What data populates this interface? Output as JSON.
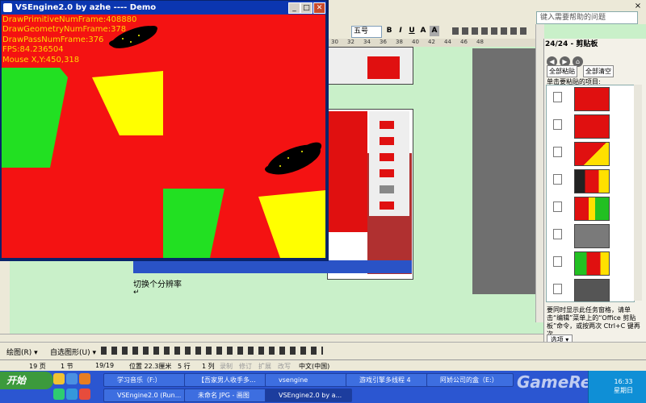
{
  "demo_window": {
    "title": "VSEngine2.0 by azhe ---- Demo",
    "minimize": "_",
    "maximize": "□",
    "close": "✕",
    "stats": [
      "DrawPrimitiveNumFrame:408880",
      "DrawGeometryNumFrame:378",
      "DrawPassNumFrame:376",
      "FPS:84.236504",
      "Mouse X,Y:450,318"
    ],
    "colors": {
      "background": "#f41212",
      "green": "#22e022",
      "yellow": "#ffff00",
      "particles": "#000000",
      "text": "#ffd700"
    }
  },
  "word": {
    "help_question_placeholder": "键入需要帮助的问题",
    "close_label": "×",
    "font_size": "五号",
    "format_buttons": [
      "B",
      "I",
      "U",
      "A",
      "A"
    ],
    "ruler_ticks": [
      "30",
      "32",
      "34",
      "36",
      "38",
      "40",
      "42",
      "44",
      "46",
      "48"
    ],
    "doc_text": "切换个分辨率",
    "paragraph_mark": "↵"
  },
  "clipboard_pane": {
    "title": "24/24 - 剪贴板",
    "paste_all": "全部粘贴",
    "clear_all": "全部清空",
    "list_label": "单击要粘贴的项目:",
    "tip": "要同时显示此任务窗格，请单击“编辑”菜单上的“Office 剪贴板”命令，或按两次 Ctrl+C 键再次。",
    "options": "选项 ▾"
  },
  "drawing_toolbar": {
    "draw_label": "绘图(R) ▾",
    "autoshapes_label": "自选图形(U) ▾"
  },
  "status_bar": {
    "page": "19 页",
    "section": "1 节",
    "page_of": "19/19",
    "position": "位置 22.3厘米",
    "line": "5 行",
    "col": "1 列",
    "rec": "录制",
    "trk": "修订",
    "ext": "扩展",
    "ovr": "改写",
    "lang": "中文(中国)"
  },
  "taskbar": {
    "start": "开始",
    "row1": [
      "学习音乐（F:）",
      "【吾家男人收手多...",
      "vsengine",
      "游戏引擎多线程 4",
      "阿娇公司的盒（E:）"
    ],
    "row2": [
      "VSEngine2.0 (Run...",
      "未命名 JPG - 画图",
      "VSEngine2.0 by a..."
    ],
    "time": "16:33",
    "day": "星期日",
    "watermark": "GameRes.com"
  }
}
